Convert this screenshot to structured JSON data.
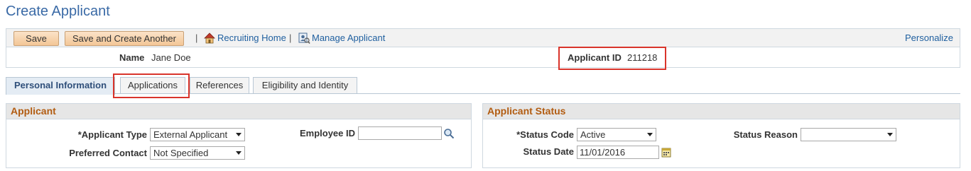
{
  "page": {
    "title": "Create Applicant"
  },
  "toolbar": {
    "save_label": "Save",
    "save_create_another_label": "Save and Create Another",
    "separator": "|",
    "recruiting_home_label": "Recruiting Home",
    "manage_applicant_label": "Manage Applicant",
    "personalize_label": "Personalize"
  },
  "header": {
    "name_label": "Name",
    "name_value": "Jane Doe",
    "applicant_id_label": "Applicant ID",
    "applicant_id_value": "211218"
  },
  "tabs": [
    {
      "label": "Personal Information",
      "active": true
    },
    {
      "label": "Applications",
      "active": false,
      "highlighted": true
    },
    {
      "label": "References",
      "active": false
    },
    {
      "label": "Eligibility and Identity",
      "active": false
    }
  ],
  "applicant": {
    "title": "Applicant",
    "applicant_type_label": "*Applicant Type",
    "applicant_type_value": "External Applicant",
    "preferred_contact_label": "Preferred Contact",
    "preferred_contact_value": "Not Specified",
    "employee_id_label": "Employee ID",
    "employee_id_value": ""
  },
  "applicant_status": {
    "title": "Applicant Status",
    "status_code_label": "*Status Code",
    "status_code_value": "Active",
    "status_date_label": "Status Date",
    "status_date_value": "11/01/2016",
    "status_reason_label": "Status Reason",
    "status_reason_value": ""
  },
  "colors": {
    "title_blue": "#3a6aa6",
    "link_blue": "#1f5f9f",
    "group_header_text": "#b25c11",
    "highlight_red": "#d9342b",
    "button_orange": "#f3c696"
  },
  "icons": {
    "recruiting_home": "home-icon",
    "manage_applicant": "manage-applicant-icon",
    "employee_lookup": "search-icon",
    "status_date_picker": "calendar-icon"
  }
}
